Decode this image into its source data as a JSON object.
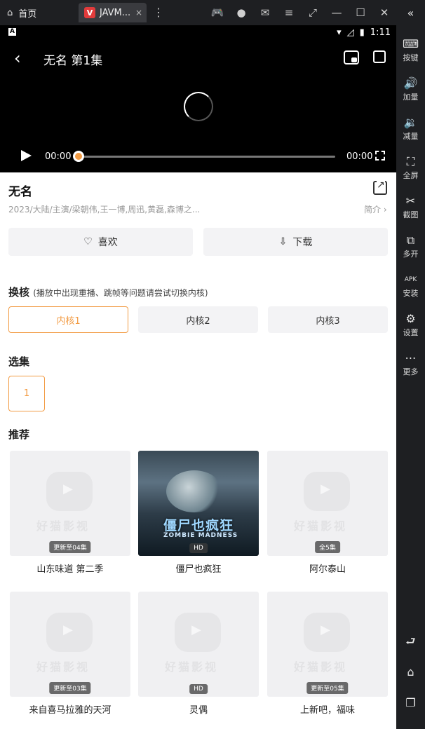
{
  "window": {
    "home_label": "首页",
    "tab_label": "JAVM...",
    "tab_close": "×",
    "kebab": "⋮",
    "toolbar_icons": [
      "gamepad-icon",
      "avatar-icon",
      "mail-icon",
      "menu-icon",
      "crop-icon",
      "minimize-icon",
      "maximize-icon",
      "close-icon"
    ]
  },
  "sidebar": {
    "collapse_icon": "«",
    "items": [
      {
        "label": "按键",
        "icon": "⌨"
      },
      {
        "label": "加量",
        "icon": "🔊"
      },
      {
        "label": "减量",
        "icon": "🔉"
      },
      {
        "label": "全屏",
        "icon": "⛶"
      },
      {
        "label": "截图",
        "icon": "✂"
      },
      {
        "label": "多开",
        "icon": "⧉"
      },
      {
        "label": "安装",
        "icon": "APK"
      },
      {
        "label": "设置",
        "icon": "⚙"
      },
      {
        "label": "更多",
        "icon": "⋯"
      }
    ],
    "bottom_icons": [
      "back-icon",
      "home-icon",
      "recents-icon"
    ]
  },
  "status": {
    "time": "1:11",
    "left_badge": "A"
  },
  "player": {
    "title": "无名 第1集",
    "current_time": "00:00",
    "duration": "00:00",
    "progress": 0
  },
  "info": {
    "title": "无名",
    "meta": "2023/大陆/主演/梁朝伟,王一博,周迅,黄磊,森博之...",
    "brief": "简介 ›",
    "like_label": "喜欢",
    "download_label": "下载"
  },
  "kernel": {
    "heading": "换核",
    "hint": "(播放中出现重播、跳帧等问题请尝试切换内核)",
    "options": [
      "内核1",
      "内核2",
      "内核3"
    ],
    "selected": 0
  },
  "episodes": {
    "heading": "选集",
    "items": [
      "1"
    ]
  },
  "recommend": {
    "heading": "推荐",
    "placeholder_text": "好猫影视",
    "items": [
      {
        "title": "山东味道 第二季",
        "badge": "更新至04集"
      },
      {
        "title": "僵尸也疯狂",
        "badge": "HD",
        "poster_title": "僵尸也疯狂",
        "poster_sub": "ZOMBIE MADNESS"
      },
      {
        "title": "阿尔泰山",
        "badge": "全5集"
      },
      {
        "title": "来自喜马拉雅的天河",
        "badge": "更新至03集"
      },
      {
        "title": "灵偶",
        "badge": "HD"
      },
      {
        "title": "上新吧，福味",
        "badge": "更新至05集"
      }
    ]
  },
  "colors": {
    "accent": "#f29b43",
    "player_bg": "#000000"
  }
}
